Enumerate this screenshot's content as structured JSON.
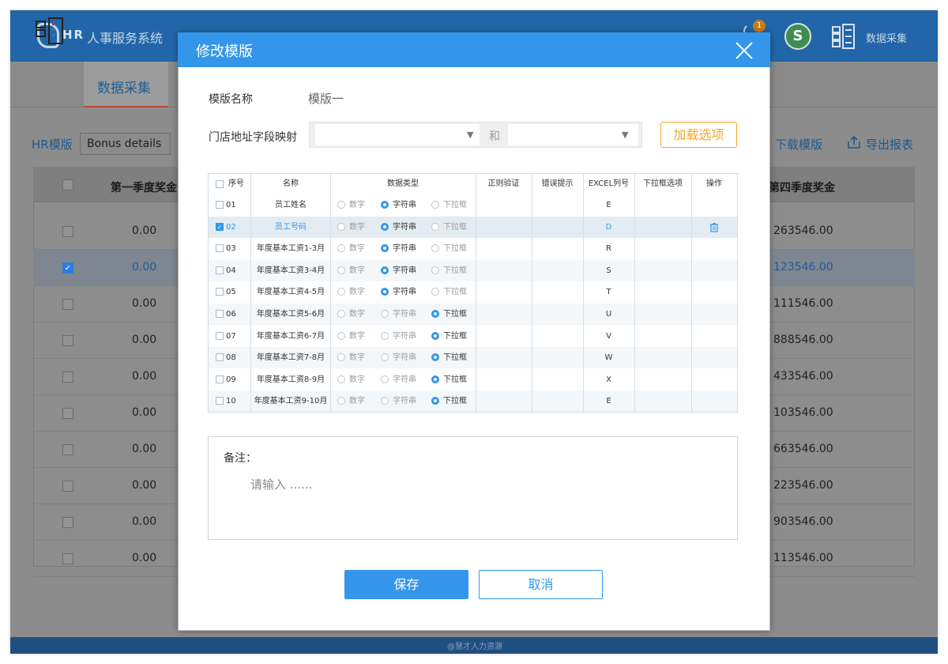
{
  "app": {
    "logo": "HR",
    "title": "人事服务系统",
    "notification_count": "1",
    "top_link": "数据采集",
    "footer": "@慧才人力资源"
  },
  "subnav": {
    "active_tab": "数据采集"
  },
  "toolbar": {
    "template_label": "HR模版",
    "template_value": "Bonus details",
    "download": "下载模版",
    "export": "导出报表"
  },
  "grid": {
    "header_left": "第一季度奖金",
    "header_right": "第四季度奖金",
    "rows": [
      {
        "checked": false,
        "left": "0.00",
        "right": "263546.00"
      },
      {
        "checked": true,
        "left": "0.00",
        "right": "123546.00"
      },
      {
        "checked": false,
        "left": "0.00",
        "right": "111546.00"
      },
      {
        "checked": false,
        "left": "0.00",
        "right": "888546.00"
      },
      {
        "checked": false,
        "left": "0.00",
        "right": "433546.00"
      },
      {
        "checked": false,
        "left": "0.00",
        "right": "103546.00"
      },
      {
        "checked": false,
        "left": "0.00",
        "right": "663546.00"
      },
      {
        "checked": false,
        "left": "0.00",
        "right": "223546.00"
      },
      {
        "checked": false,
        "left": "0.00",
        "right": "903546.00"
      },
      {
        "checked": false,
        "left": "0.00",
        "right": "113546.00"
      }
    ]
  },
  "modal": {
    "title": "修改模版",
    "name_label": "模版名称",
    "name_value": "模版一",
    "map_label": "门店地址字段映射",
    "map_and": "和",
    "load_button": "加载选项",
    "table": {
      "headers": [
        "序号",
        "名称",
        "数据类型",
        "正则验证",
        "错误提示",
        "EXCEL列号",
        "下拉框选项",
        "操作"
      ],
      "type_options": [
        "数字",
        "字符串",
        "下拉框"
      ],
      "rows": [
        {
          "no": "01",
          "name": "员工姓名",
          "type": 1,
          "col": "E",
          "checked": false,
          "selected": false
        },
        {
          "no": "02",
          "name": "员工号码",
          "type": 1,
          "col": "D",
          "checked": true,
          "selected": true
        },
        {
          "no": "03",
          "name": "年度基本工资1-3月",
          "type": 1,
          "col": "R",
          "checked": false,
          "selected": false
        },
        {
          "no": "04",
          "name": "年度基本工资3-4月",
          "type": 1,
          "col": "S",
          "checked": false,
          "selected": false
        },
        {
          "no": "05",
          "name": "年度基本工资4-5月",
          "type": 1,
          "col": "T",
          "checked": false,
          "selected": false
        },
        {
          "no": "06",
          "name": "年度基本工资5-6月",
          "type": 2,
          "col": "U",
          "checked": false,
          "selected": false
        },
        {
          "no": "07",
          "name": "年度基本工资6-7月",
          "type": 2,
          "col": "V",
          "checked": false,
          "selected": false
        },
        {
          "no": "08",
          "name": "年度基本工资7-8月",
          "type": 2,
          "col": "W",
          "checked": false,
          "selected": false
        },
        {
          "no": "09",
          "name": "年度基本工资8-9月",
          "type": 2,
          "col": "X",
          "checked": false,
          "selected": false
        },
        {
          "no": "10",
          "name": "年度基本工资9-10月",
          "type": 2,
          "col": "E",
          "checked": false,
          "selected": false
        }
      ]
    },
    "notes_label": "备注：",
    "notes_placeholder": "请输入 ......",
    "save": "保存",
    "cancel": "取消"
  },
  "colors": {
    "primary": "#3396ea",
    "topbar": "#2266a9",
    "load_button": "#f5a623"
  },
  "icons": [
    "logo-icon",
    "notification-icon",
    "avatar-icon",
    "data-collect-icon",
    "upload-icon",
    "close-icon",
    "trash-icon",
    "dropdown-arrow-icon"
  ]
}
